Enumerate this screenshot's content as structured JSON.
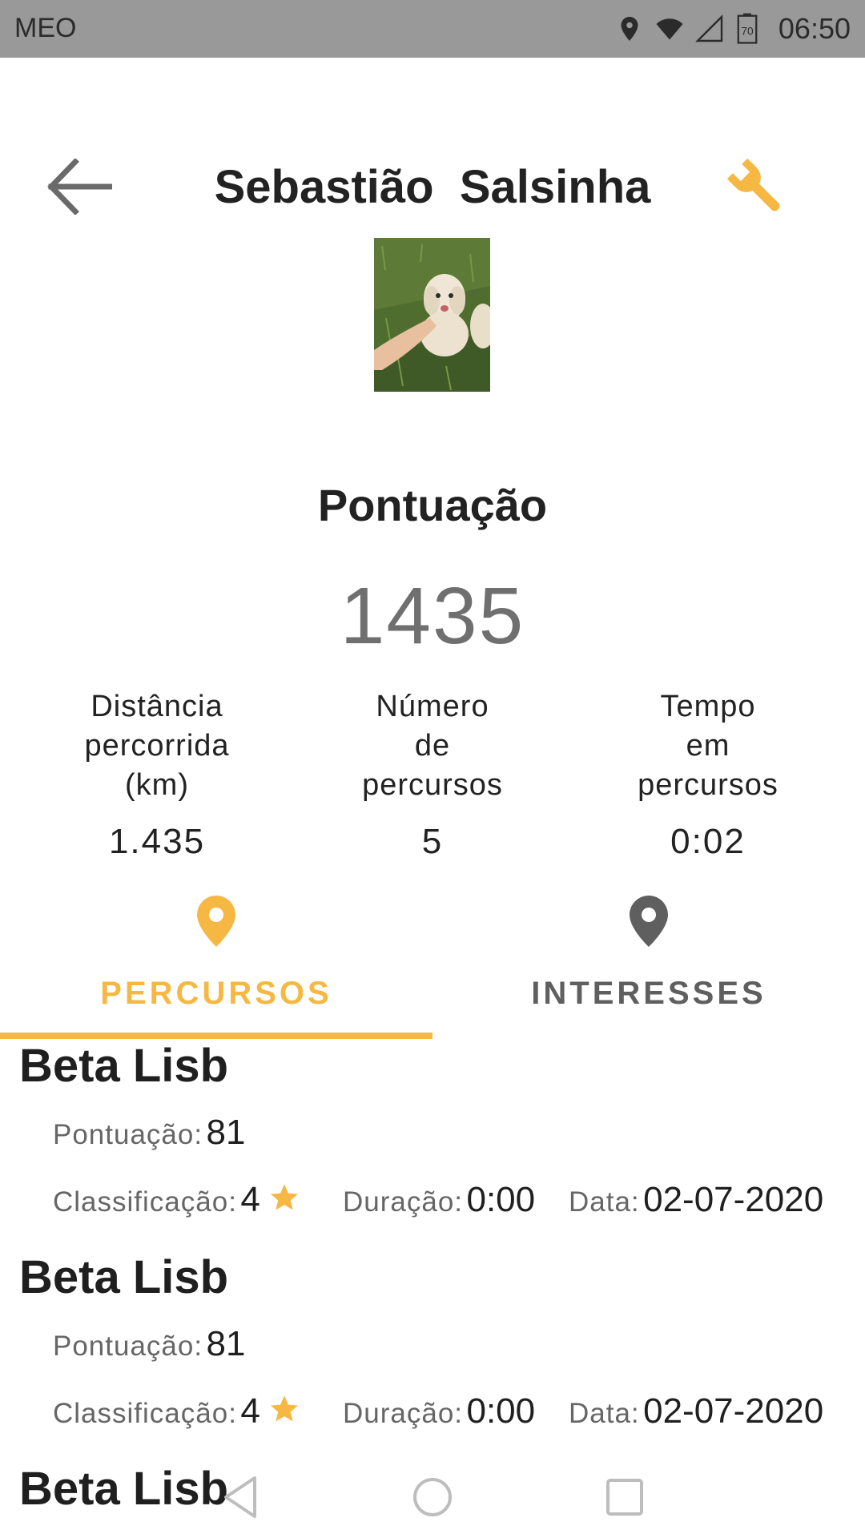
{
  "status_bar": {
    "carrier": "MEO",
    "time": "06:50",
    "battery": "70"
  },
  "header": {
    "title": "Sebastião  Salsinha"
  },
  "score": {
    "label": "Pontuação",
    "value": "1435"
  },
  "stats": [
    {
      "label_lines": [
        "Distância",
        "percorrida",
        "(km)"
      ],
      "value": "1.435"
    },
    {
      "label_lines": [
        "Número",
        "de",
        "percursos"
      ],
      "value": "5"
    },
    {
      "label_lines": [
        "Tempo",
        "em",
        "percursos"
      ],
      "value": "0:02"
    }
  ],
  "tabs": [
    {
      "label": "PERCURSOS",
      "active": true
    },
    {
      "label": "INTERESSES",
      "active": false
    }
  ],
  "labels": {
    "score": "Pontuação:",
    "rating": "Classificação:",
    "duration": "Duração:",
    "date": "Data:"
  },
  "routes": [
    {
      "name": "Beta Lisb",
      "score": "81",
      "rating": "4",
      "duration": "0:00",
      "date": "02-07-2020"
    },
    {
      "name": "Beta Lisb",
      "score": "81",
      "rating": "4",
      "duration": "0:00",
      "date": "02-07-2020"
    },
    {
      "name": "Beta Lisb"
    }
  ],
  "colors": {
    "accent": "#F7B843",
    "inactive": "#5f5f5f",
    "status_bar": "#999999",
    "divider": "#b4c4d2"
  },
  "icons": {
    "back": "arrow-left-icon",
    "settings": "wrench-icon",
    "tab_pin": "location-pin-icon",
    "nav": [
      "nav-back-icon",
      "nav-home-icon",
      "nav-recents-icon"
    ]
  }
}
